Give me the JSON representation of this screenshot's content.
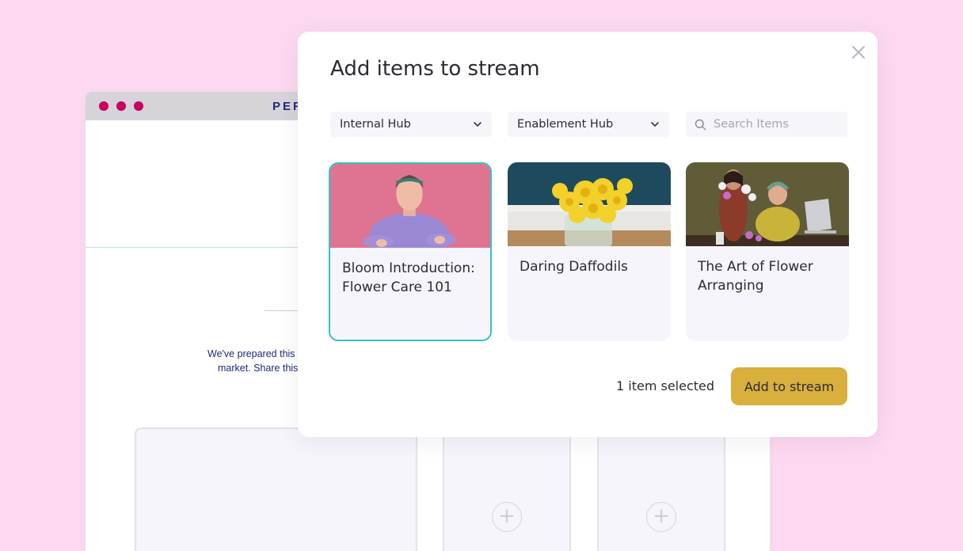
{
  "background_page": {
    "brand": "PER",
    "text_line_1": "We've prepared this",
    "text_line_2": "market. Share this",
    "add_slot_icon": "plus-circle-icon"
  },
  "modal": {
    "title": "Add items to stream",
    "close_icon": "close-icon",
    "filters": {
      "hub_select": "Internal Hub",
      "hub_select_2": "Enablement Hub",
      "search_placeholder": "Search Items"
    },
    "items": [
      {
        "title": "Bloom Introduction: Flower Care 101",
        "selected": true
      },
      {
        "title": "Daring Daffodils",
        "selected": false
      },
      {
        "title": "The Art of Flower Arranging",
        "selected": false
      }
    ],
    "footer": {
      "selected_text": "1 item selected",
      "add_button": "Add to stream"
    }
  },
  "colors": {
    "page_background": "#fcd9f1",
    "accent_teal": "#32c3c3",
    "button_gold": "#d9af3d",
    "traffic_light": "#c8005f",
    "brand_navy": "#1f2a7a"
  }
}
